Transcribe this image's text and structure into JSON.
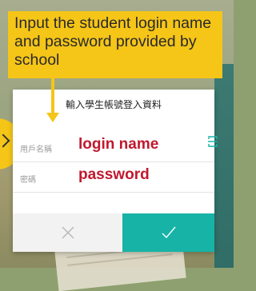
{
  "callout": {
    "text": "Input the student login name and password provided by school"
  },
  "dialog": {
    "title": "輸入學生帳號登入資料",
    "username": {
      "label": "用戶名稱",
      "value": "login name"
    },
    "password": {
      "label": "密碼",
      "value": "password"
    },
    "cancel_icon": "close-icon",
    "confirm_icon": "checkmark-icon"
  },
  "colors": {
    "callout": "#f5c518",
    "accent": "#17b3a6",
    "highlight_text": "#c0182e"
  }
}
